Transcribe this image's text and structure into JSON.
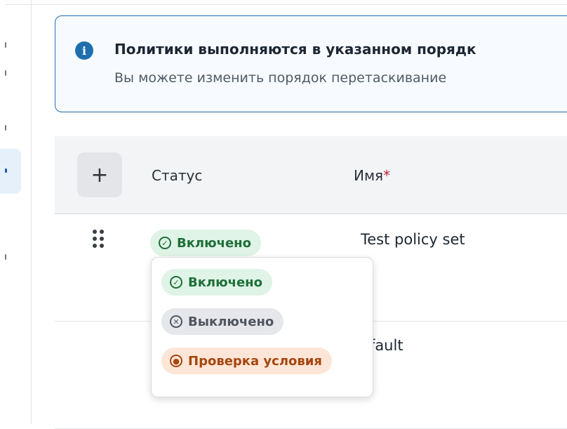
{
  "banner": {
    "title": "Политики выполняются в указанном порядк",
    "subtitle": "Вы можете изменить порядок перетаскивание"
  },
  "table": {
    "columns": {
      "status": "Статус",
      "name": "Имя",
      "required_mark": "*"
    },
    "rows": [
      {
        "status": "Включено",
        "name": "Test policy set"
      },
      {
        "name": "efault"
      }
    ]
  },
  "status_menu": {
    "options": [
      {
        "label": "Включено",
        "icon": "check-circle-icon"
      },
      {
        "label": "Выключено",
        "icon": "x-circle-icon"
      },
      {
        "label": "Проверка условия",
        "icon": "eye-icon"
      }
    ]
  },
  "colors": {
    "accent": "#1f6fae",
    "enabled": "#1e6f38",
    "disabled": "#4f5560",
    "checking": "#a5460f"
  }
}
